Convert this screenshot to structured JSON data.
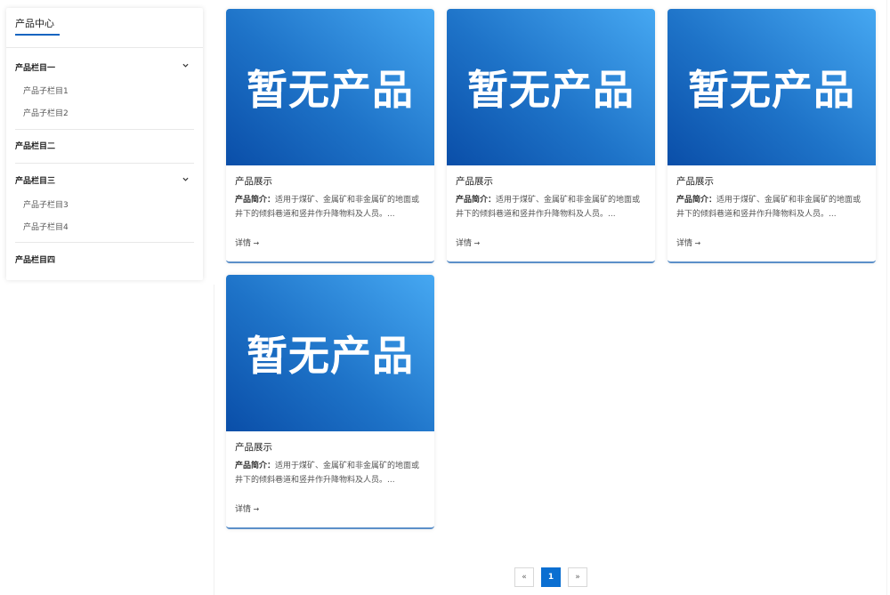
{
  "sidebar": {
    "title": "产品中心",
    "categories": [
      {
        "label": "产品栏目一",
        "expanded": true,
        "children": [
          "产品子栏目1",
          "产品子栏目2"
        ]
      },
      {
        "label": "产品栏目二",
        "expanded": false,
        "children": []
      },
      {
        "label": "产品栏目三",
        "expanded": true,
        "children": [
          "产品子栏目3",
          "产品子栏目4"
        ]
      },
      {
        "label": "产品栏目四",
        "expanded": false,
        "children": []
      }
    ]
  },
  "products": [
    {
      "image_text": "暂无产品",
      "title": "产品展示",
      "desc_label": "产品简介：",
      "desc_text": "适用于煤矿、金属矿和非金属矿的地面或井下的倾斜巷道和竖井作升降物料及人员。...",
      "more": "详情"
    },
    {
      "image_text": "暂无产品",
      "title": "产品展示",
      "desc_label": "产品简介：",
      "desc_text": "适用于煤矿、金属矿和非金属矿的地面或井下的倾斜巷道和竖井作升降物料及人员。...",
      "more": "详情"
    },
    {
      "image_text": "暂无产品",
      "title": "产品展示",
      "desc_label": "产品简介：",
      "desc_text": "适用于煤矿、金属矿和非金属矿的地面或井下的倾斜巷道和竖井作升降物料及人员。...",
      "more": "详情"
    },
    {
      "image_text": "暂无产品",
      "title": "产品展示",
      "desc_label": "产品简介：",
      "desc_text": "适用于煤矿、金属矿和非金属矿的地面或井下的倾斜巷道和竖井作升降物料及人员。...",
      "more": "详情"
    }
  ],
  "pagination": {
    "prev": "«",
    "current": "1",
    "next": "»"
  },
  "colors": {
    "accent": "#0b6fd1",
    "card_border": "#5b8fc9"
  }
}
